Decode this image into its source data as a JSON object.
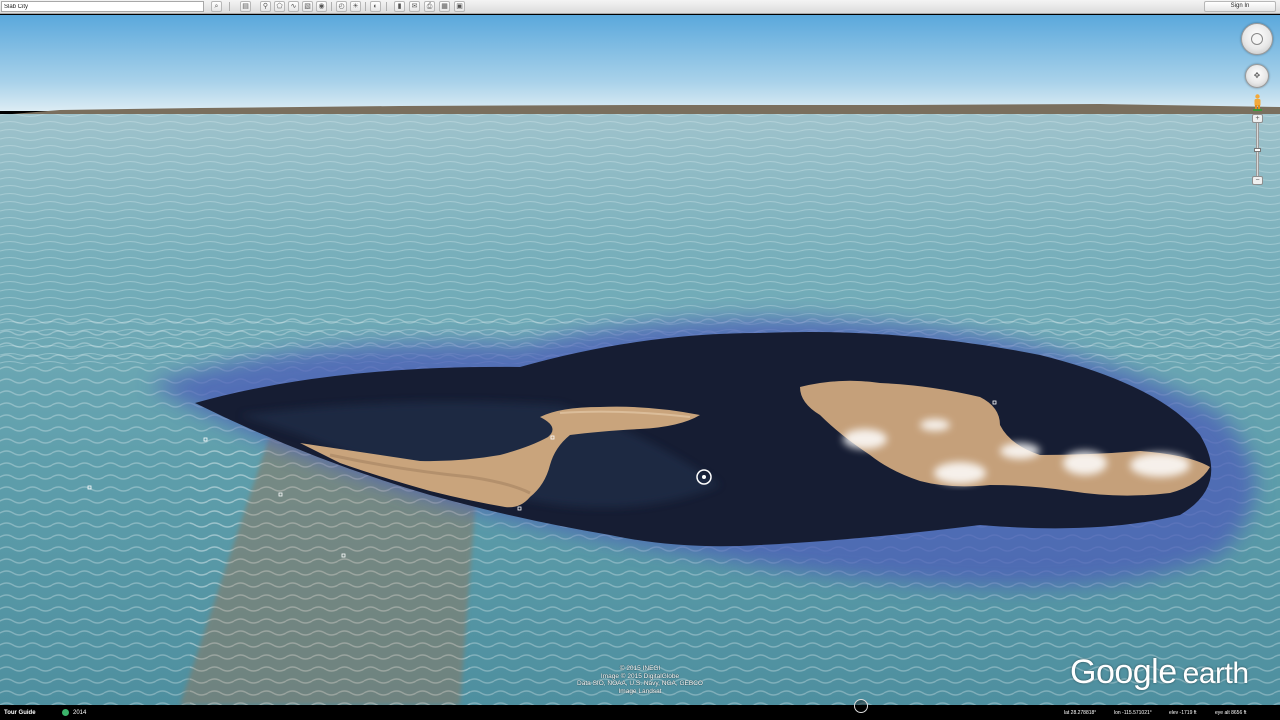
{
  "toolbar": {
    "search_value": "Slab City",
    "sign_in_label": "Sign In",
    "buttons": [
      "search-icon",
      "sidebar-icon",
      "placemark-icon",
      "polygon-icon",
      "path-icon",
      "overlay-icon",
      "tour-icon",
      "history-icon",
      "sun-icon",
      "planets-icon",
      "ruler-icon",
      "email-icon",
      "print-icon",
      "maps-icon"
    ]
  },
  "status": {
    "tour_guide": "Tour Guide",
    "year": "2014",
    "lat": "lat   28.278818°",
    "lon": "lon  -115.571021°",
    "elev": "elev  -1719 ft",
    "eye_alt": "eye alt   8656 ft"
  },
  "attribution": {
    "lines": [
      "© 2015 INEGI",
      "Image © 2015 DigitalGlobe",
      "Data SIO, NOAA, U.S. Navy, NGA, GEBCO",
      "Image Landsat"
    ]
  },
  "logo": {
    "google": "Google",
    "earth": "earth"
  },
  "colors": {
    "sky_top": "#5aa8dc",
    "sea": "#6aa4ae",
    "deep_water": "#151c2e",
    "land": "#c9a47c"
  }
}
